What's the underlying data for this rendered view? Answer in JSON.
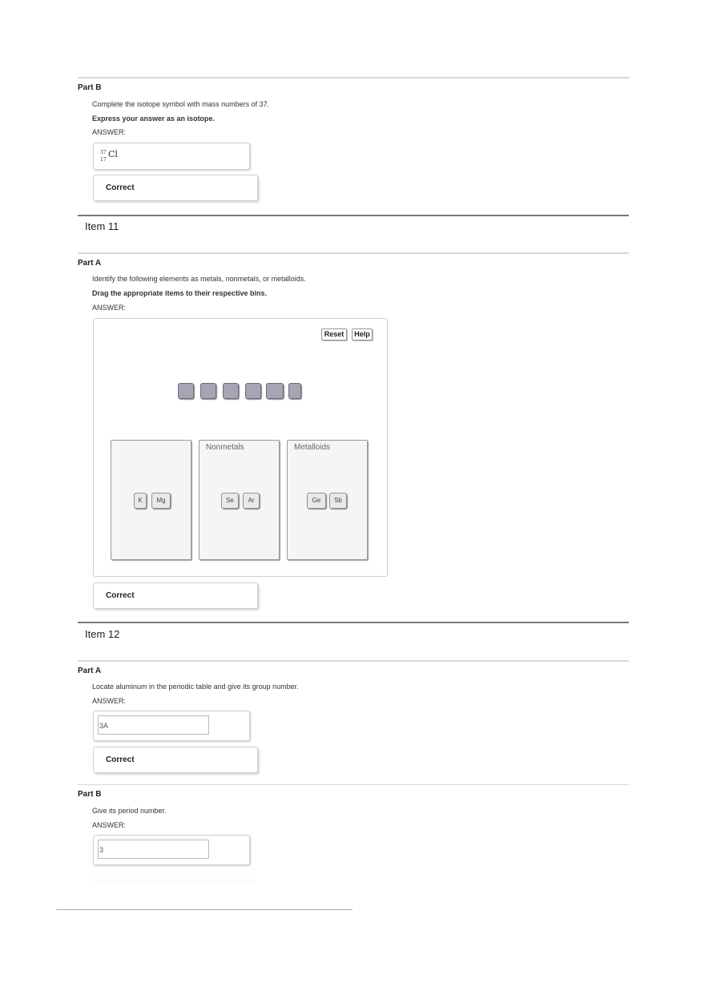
{
  "item10_partB": {
    "part_label": "Part B",
    "question": "Complete the isotope symbol with mass numbers of 37.",
    "instruction": "Express your answer as an isotope.",
    "answer_label": "ANSWER:",
    "isotope": {
      "mass": "37",
      "atomic": "17",
      "symbol": "Cl"
    },
    "result": "Correct"
  },
  "item11": {
    "title": "Item 11",
    "part_label": "Part A",
    "question": "Identify the following elements as metals, nonmetals, or metalloids.",
    "instruction": "Drag the appropriate items to their respective bins.",
    "answer_label": "ANSWER:",
    "reset_label": "Reset",
    "help_label": "Help",
    "bins": [
      {
        "label": "",
        "items": [
          "K",
          "Mg"
        ]
      },
      {
        "label": "Nonmetals",
        "items": [
          "Se",
          "Ar"
        ]
      },
      {
        "label": "Metalloids",
        "items": [
          "Ge",
          "Sb"
        ]
      }
    ],
    "result": "Correct"
  },
  "item12": {
    "title": "Item 12",
    "partA": {
      "part_label": "Part A",
      "question": "Locate aluminum in the periodic table and give its group number.",
      "answer_label": "ANSWER:",
      "value": "3A",
      "result": "Correct"
    },
    "partB": {
      "part_label": "Part B",
      "question": "Give its period number.",
      "answer_label": "ANSWER:",
      "value": "3"
    }
  }
}
